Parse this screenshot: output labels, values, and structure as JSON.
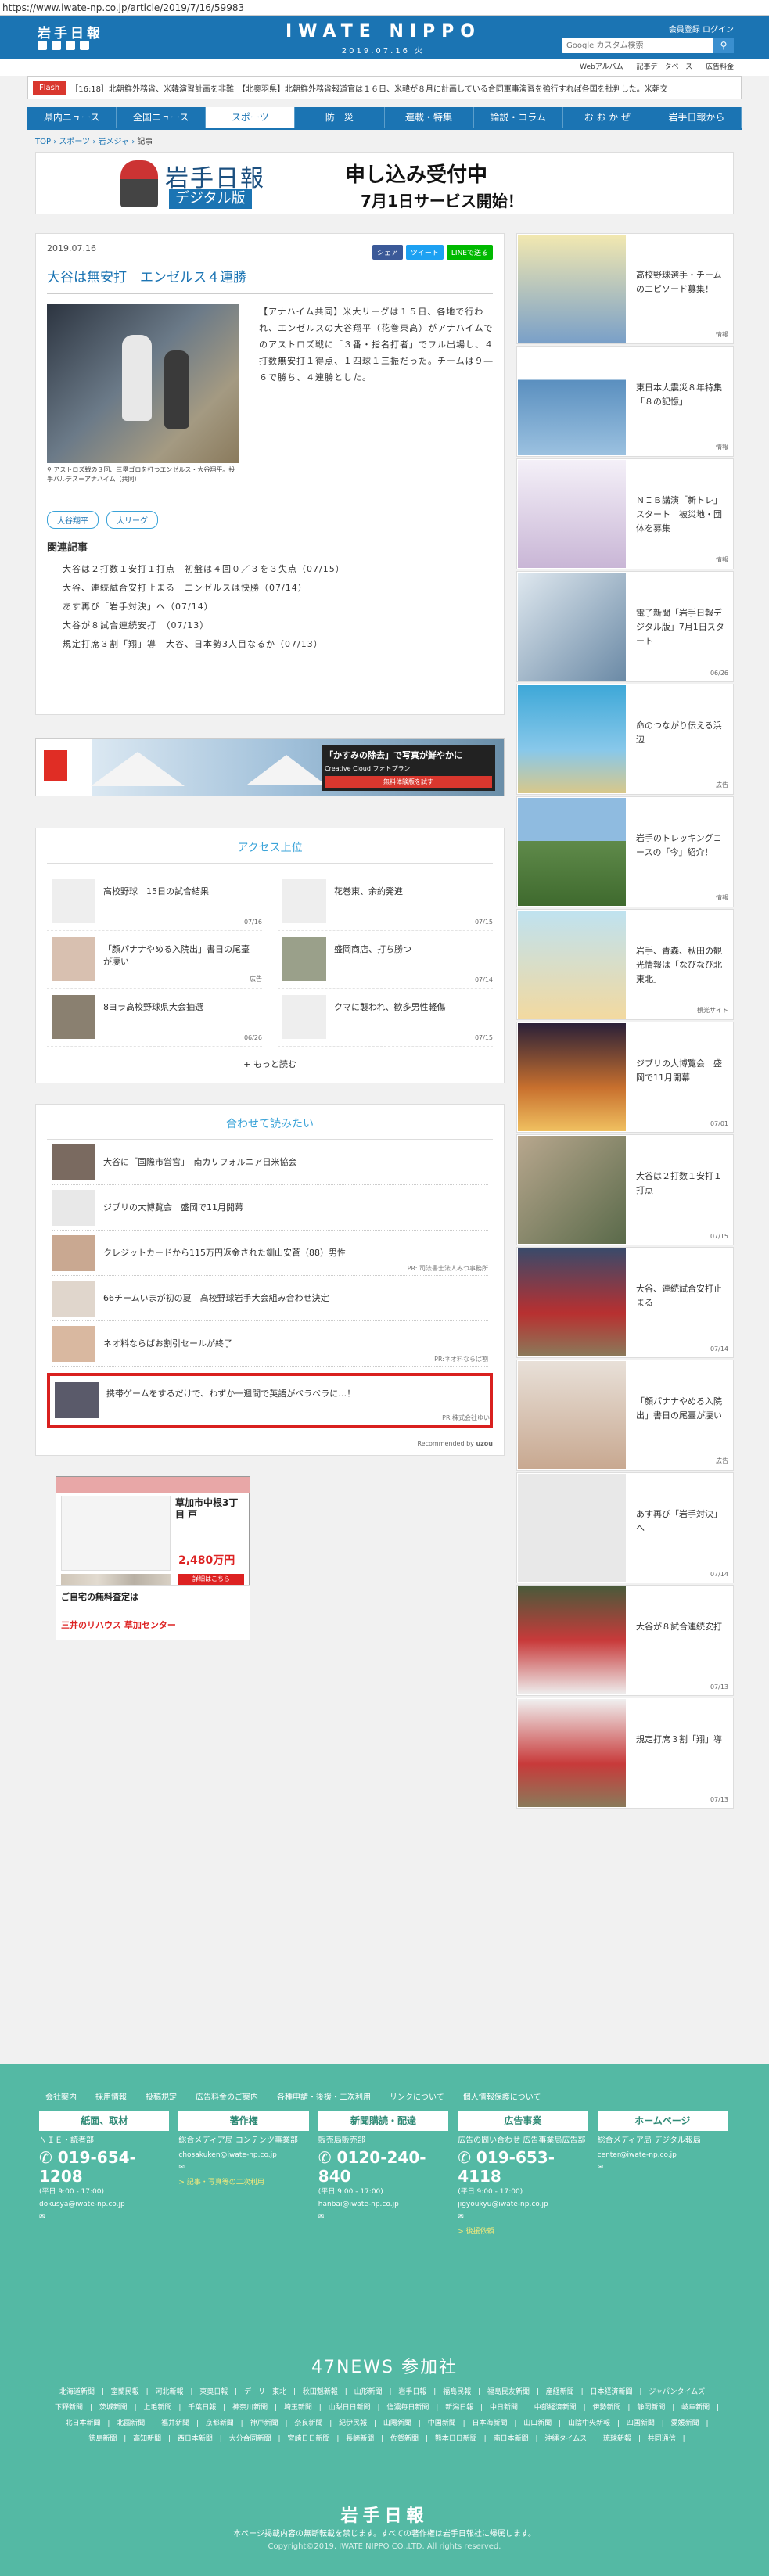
{
  "url": "https://www.iwate-np.co.jp/article/2019/7/16/59983",
  "header": {
    "logo": "岩手日報",
    "brand": "IWATE NIPPO",
    "date": "2019.07.16 火",
    "member": "会員登録  ログイン",
    "search_placeholder": "Google カスタム検索",
    "sublinks": [
      "Webアルバム",
      "記事データベース",
      "広告料金"
    ]
  },
  "flash": {
    "tag": "Flash",
    "text": "［16:18］北朝鮮外務省、米韓演習計画を非難　【北奥羽県】北朝鮮外務省報道官は１６日、米韓が８月に計画している合同軍事演習を強行すれば各国を批判した。米朝交"
  },
  "nav": [
    "県内ニュース",
    "全国ニュース",
    "スポーツ",
    "防　災",
    "連載・特集",
    "論説・コラム",
    "お お か ぜ",
    "岩手日報から"
  ],
  "breadcrumb": [
    "TOP",
    "スポーツ",
    "岩メジャ",
    "記事"
  ],
  "banner": {
    "logo": "岩手日報",
    "digital": "デジタル版",
    "line1": "申し込み受付中",
    "line2": "7月1日サービス開始！"
  },
  "article": {
    "date": "2019.07.16",
    "share": [
      "シェア",
      "ツイート",
      "LINEで送る"
    ],
    "title": "大谷は無安打　エンゼルス４連勝",
    "caption": "アストロズ戦の３回、三塁ゴロを打つエンゼルス・大谷翔平。投手バルデス＝アナハイム（共同）",
    "body": "【アナハイム共同】米大リーグは１５日、各地で行われ、エンゼルスの大谷翔平（花巻東高）がアナハイムでのアストロズ戦に「３番・指名打者」でフル出場し、４打数無安打１得点、１四球１三振だった。チームは９―６で勝ち、４連勝とした。",
    "tags": [
      "大谷翔平",
      "大リーグ"
    ],
    "related_title": "関連記事",
    "related": [
      "大谷は２打数１安打１打点　初盤は４回０／３を３失点（07/15）",
      "大谷、連続試合安打止まる　エンゼルスは快勝（07/14）",
      "あす再び「岩手対決」へ（07/14）",
      "大谷が８試合連続安打　（07/13）",
      "規定打席３割「翔」導　大谷、日本勢3人目なるか（07/13）"
    ]
  },
  "ad_adobe": {
    "title": "「かすみの除去」で写真が鮮やかに",
    "sub": "Creative Cloud フォトプラン",
    "btn": "無料体験版を試す"
  },
  "access": {
    "title": "アクセス上位",
    "items": [
      {
        "title": "高校野球　15日の試合結果",
        "date": "07/16"
      },
      {
        "title": "花巻東、余約発進",
        "date": "07/15"
      },
      {
        "title": "「顔パナナやめる入院出」書日の尾臺が凄い",
        "date": "広告"
      },
      {
        "title": "盛岡商店、打ち勝つ",
        "date": "07/14"
      },
      {
        "title": "8ヨラ高校野球県大会抽選",
        "date": "06/26"
      },
      {
        "title": "クマに襲われ、歓多男性軽傷",
        "date": "07/15"
      }
    ],
    "more": "もっと読む"
  },
  "reco": {
    "title": "合わせて読みたい",
    "items": [
      {
        "title": "大谷に「国際市営宮」　南カリフォルニア日米協会",
        "pr": ""
      },
      {
        "title": "ジブリの大博覧会　盛岡で11月開幕",
        "pr": ""
      },
      {
        "title": "クレジットカードから115万円返金された釧山安蒼（88）男性",
        "pr": "PR: 司法書士法人みつ事務所"
      },
      {
        "title": "66チームいまが初の夏　高校野球岩手大会組み合わせ決定",
        "pr": ""
      },
      {
        "title": "ネオ料ならばお割引セールが終了",
        "pr": "PR:ネオ料ならば割"
      },
      {
        "title": "携帯ゲームをするだけで、わずか一週間で英語がペラペラに…！",
        "pr": "PR:株式会社ゆい"
      }
    ],
    "foot": "Recommended by"
  },
  "ad_house": {
    "title": "草加市中根3丁目 戸",
    "price": "2,480万円",
    "btn": "詳細はこちら",
    "foot1": "ご自宅の無料査定は",
    "foot2": "三井のリハウス 草加センター"
  },
  "side": [
    {
      "title": "高校野球選手・チームのエピソード募集！",
      "date": "情報"
    },
    {
      "title": "東日本大震災８年特集「８の記憶」",
      "date": "情報"
    },
    {
      "title": "ＮＩＢ講演「新トレ」スタート　被災地・団体を募集",
      "date": "情報"
    },
    {
      "title": "電子新聞「岩手日報デジタル版」7月1日スタート",
      "date": "06/26"
    },
    {
      "title": "命のつながり伝える浜辺",
      "date": "広告"
    },
    {
      "title": "岩手のトレッキングコースの「今」紹介！",
      "date": "情報"
    },
    {
      "title": "岩手、青森、秋田の観光情報は「なびなび北東北」",
      "date": "観光サイト"
    },
    {
      "title": "ジブリの大博覧会　盛岡で11月開幕",
      "date": "07/01"
    },
    {
      "title": "大谷は２打数１安打１打点",
      "date": "07/15"
    },
    {
      "title": "大谷、連続試合安打止まる",
      "date": "07/14"
    },
    {
      "title": "「顔パナナやめる入院出」書日の尾臺が凄い",
      "date": "広告"
    },
    {
      "title": "あす再び「岩手対決」へ",
      "date": "07/14"
    },
    {
      "title": "大谷が８試合連続安打",
      "date": "07/13"
    },
    {
      "title": "規定打席３割「翔」導",
      "date": "07/13"
    }
  ],
  "footer": {
    "links": [
      "会社案内",
      "採用情報",
      "投稿規定",
      "広告料金のご案内",
      "各種申請・後援・二次利用",
      "リンクについて",
      "個人情報保護について"
    ],
    "cols": [
      {
        "head": "紙面、取材",
        "p1": "ＮＩＥ・読者部",
        "tel": "019-654-1208",
        "small": "(平日 9:00 - 17:00)",
        "mail": "dokusya@iwate-np.co.jp",
        "link": ""
      },
      {
        "head": "著作権",
        "p1": "総合メディア局 コンテンツ事業部",
        "tel": "",
        "small": "",
        "mail": "chosakuken@iwate-np.co.jp",
        "link": "> 記事・写真等の二次利用"
      },
      {
        "head": "新聞購読・配達",
        "p1": "販売局販売部",
        "tel": "0120-240-840",
        "small": "(平日 9:00 - 17:00)",
        "mail": "hanbai@iwate-np.co.jp",
        "link": ""
      },
      {
        "head": "広告事業",
        "p1": "広告の問い合わせ 広告事業局広告部",
        "tel": "019-653-4118",
        "small": "(平日 9:00 - 17:00)",
        "mail": "jigyoukyu@iwate-np.co.jp",
        "link": "> 後援依頼"
      },
      {
        "head": "ホームページ",
        "p1": "総合メディア局 デジタル報局",
        "tel": "",
        "small": "",
        "mail": "center@iwate-np.co.jp",
        "link": ""
      }
    ],
    "news_title": "47NEWS 参加社",
    "papers": [
      "北海道新聞",
      "室蘭民報",
      "河北新報",
      "東奥日報",
      "デーリー東北",
      "秋田魁新報",
      "山形新聞",
      "岩手日報",
      "福島民報",
      "福島民友新聞",
      "産経新聞",
      "日本経済新聞",
      "ジャパンタイムズ",
      "下野新聞",
      "茨城新聞",
      "上毛新聞",
      "千葉日報",
      "神奈川新聞",
      "埼玉新聞",
      "山梨日日新聞",
      "信濃毎日新聞",
      "新潟日報",
      "中日新聞",
      "中部経済新聞",
      "伊勢新聞",
      "静岡新聞",
      "岐阜新聞",
      "北日本新聞",
      "北國新聞",
      "福井新聞",
      "京都新聞",
      "神戸新聞",
      "奈良新聞",
      "紀伊民報",
      "山陽新聞",
      "中国新聞",
      "日本海新聞",
      "山口新聞",
      "山陰中央新報",
      "四国新聞",
      "愛媛新聞",
      "徳島新聞",
      "高知新聞",
      "西日本新聞",
      "大分合同新聞",
      "宮崎日日新聞",
      "長崎新聞",
      "佐賀新聞",
      "熊本日日新聞",
      "南日本新聞",
      "沖縄タイムス",
      "琉球新報",
      "共同通信"
    ],
    "logo": "岩手日報",
    "copy1": "本ページ掲載内容の無断転載を禁じます。すべての著作権は岩手日報社に帰属します。",
    "copy2": "Copyright©2019, IWATE NIPPO CO.,LTD. All rights reserved."
  }
}
